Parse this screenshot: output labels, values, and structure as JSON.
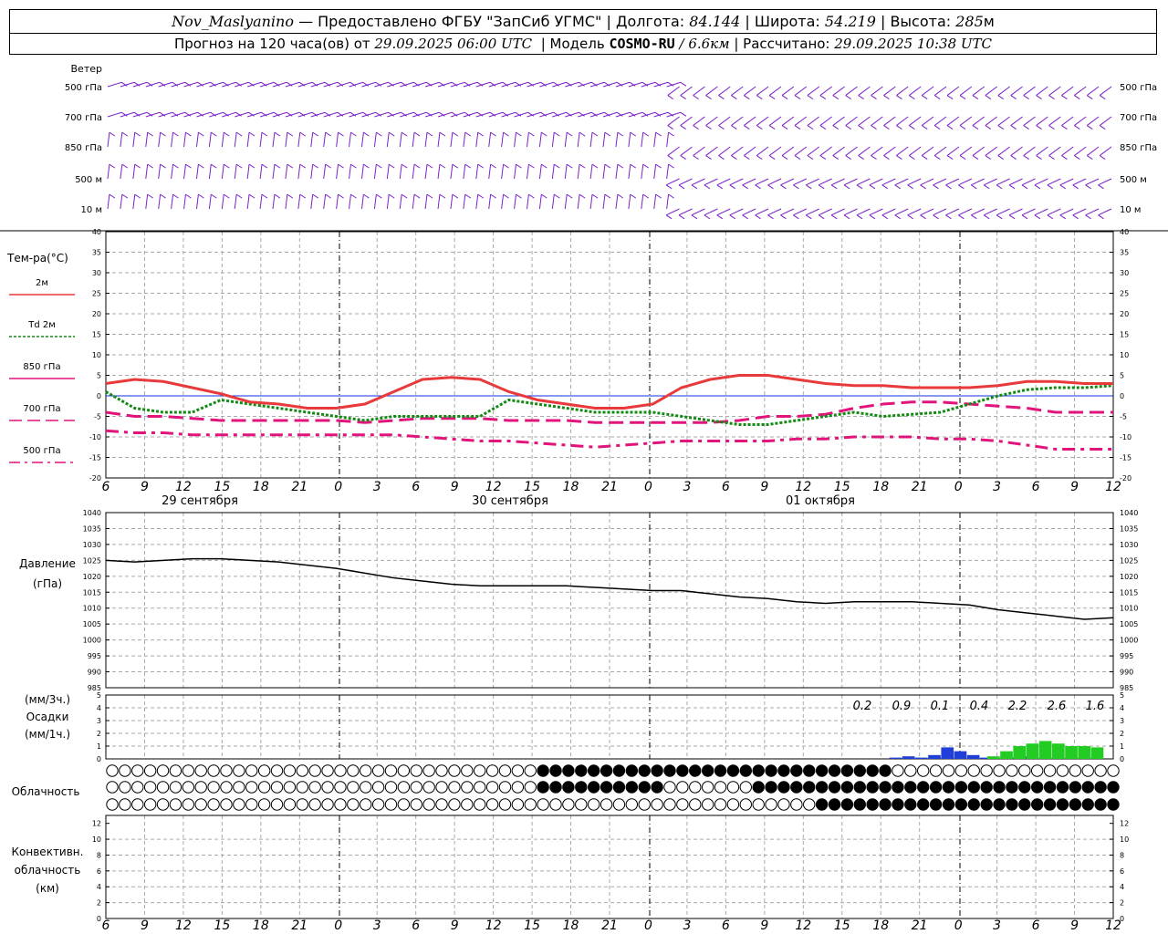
{
  "header": {
    "station": "Nov_Maslyanino",
    "provider": "— Предоставлено ФГБУ \"ЗапСиб УГМС\"",
    "lon_label": "Долгота:",
    "lon": "84.144",
    "lat_label": "Широта:",
    "lat": "54.219",
    "alt_label": "Высота:",
    "alt": "285",
    "alt_unit": "м",
    "forecast_label": "Прогноз на 120 часа(ов) от",
    "forecast_start": "29.09.2025 06:00 UTC",
    "model_label": "Модель",
    "model": "COSMO-RU",
    "resolution": "/ 6.6км",
    "calc_label": "Рассчитано:",
    "calc_time": "29.09.2025 10:38 UTC"
  },
  "wind": {
    "title": "Ветер",
    "levels": [
      "500 гПа",
      "700 гПа",
      "850 гПа",
      "500 м",
      "10  м"
    ]
  },
  "temperature": {
    "title": "Тем-ра(°С)",
    "ylim": [
      -20,
      40
    ],
    "yticks": [
      "40",
      "35",
      "30",
      "25",
      "20",
      "15",
      "10",
      "5",
      "0",
      "-5",
      "-10",
      "-15",
      "-20"
    ],
    "legend": [
      {
        "label": "2м",
        "color": "#e8393b",
        "dash": "solid"
      },
      {
        "label": "Td  2м",
        "color": "#138a13",
        "dash": "dotted"
      },
      {
        "label": "850 гПа",
        "color": "#e0147a",
        "dash": "solid"
      },
      {
        "label": "700 гПа",
        "color": "#e0147a",
        "dash": "long"
      },
      {
        "label": "500 гПа",
        "color": "#e0147a",
        "dash": "dashdot"
      }
    ],
    "hour_ticks": [
      "6",
      "9",
      "12",
      "15",
      "18",
      "21",
      "0",
      "3",
      "6",
      "9",
      "12",
      "15",
      "18",
      "21",
      "0",
      "3",
      "6",
      "9",
      "12",
      "15",
      "18",
      "21",
      "0",
      "3",
      "6",
      "9",
      "12"
    ],
    "dates": [
      "29 сентября",
      "30 сентября",
      "01 октября"
    ],
    "series": {
      "t2m": [
        3,
        4,
        3.5,
        2,
        0.5,
        -1.5,
        -2,
        -3,
        -3,
        -2,
        1,
        4,
        4.5,
        4,
        1,
        -1,
        -2,
        -3,
        -3,
        -2,
        2,
        4,
        5,
        5,
        4,
        3,
        2.5,
        2.5,
        2,
        2,
        2,
        2.5,
        3.5,
        3.5,
        3,
        3
      ],
      "td2m": [
        1,
        -3,
        -4,
        -4,
        -1,
        -2,
        -3,
        -4,
        -5,
        -6,
        -5,
        -5,
        -5,
        -5,
        -1,
        -2,
        -3,
        -4,
        -4,
        -4,
        -5,
        -6,
        -7,
        -7,
        -6,
        -5,
        -4,
        -5,
        -4.5,
        -4,
        -2,
        0,
        1.5,
        2,
        2,
        2.5
      ],
      "t700": [
        -4,
        -5,
        -5,
        -5.5,
        -6,
        -6,
        -6,
        -6,
        -6,
        -6.5,
        -6,
        -5.5,
        -5.5,
        -5.5,
        -6,
        -6,
        -6,
        -6.5,
        -6.5,
        -6.5,
        -6.5,
        -6.5,
        -6,
        -5,
        -5,
        -4.5,
        -3,
        -2,
        -1.5,
        -1.5,
        -2,
        -2.5,
        -3,
        -4,
        -4,
        -4
      ],
      "t500": [
        -8.5,
        -9,
        -9,
        -9.5,
        -9.5,
        -9.5,
        -9.5,
        -9.5,
        -9.5,
        -9.5,
        -9.5,
        -10,
        -10.5,
        -11,
        -11,
        -11.5,
        -12,
        -12.5,
        -12,
        -11.5,
        -11,
        -11,
        -11,
        -11,
        -10.5,
        -10.5,
        -10,
        -10,
        -10,
        -10.5,
        -10.5,
        -11,
        -12,
        -13,
        -13,
        -13
      ]
    }
  },
  "chart_data": [
    {
      "type": "line",
      "title": "Давление",
      "ylabel": "(гПа)",
      "ylim": [
        985,
        1040
      ],
      "yticks": [
        "1040",
        "1035",
        "1030",
        "1025",
        "1020",
        "1015",
        "1010",
        "1005",
        "1000",
        "995",
        "990",
        "985"
      ],
      "x": [
        6,
        9,
        12,
        15,
        18,
        21,
        0,
        3,
        6,
        9,
        12,
        15,
        18,
        21,
        0,
        3,
        6,
        9,
        12,
        15,
        18,
        21,
        0,
        3,
        6,
        9,
        12,
        15,
        18,
        21,
        0,
        3,
        6,
        9,
        12
      ],
      "values": [
        1025,
        1024.5,
        1025,
        1025.5,
        1025.5,
        1025,
        1024.5,
        1023.5,
        1022.5,
        1021,
        1019.5,
        1018.5,
        1017.5,
        1017,
        1017,
        1017,
        1017,
        1016.5,
        1016,
        1015.5,
        1015.5,
        1014.5,
        1013.5,
        1013,
        1012,
        1011.5,
        1012,
        1012,
        1012,
        1011.5,
        1011,
        1009.5,
        1008.5,
        1007.5,
        1006.5,
        1007
      ]
    },
    {
      "type": "bar",
      "title": "Осадки",
      "ylabel": "(мм/3ч.) (мм/1ч.)",
      "ylim": [
        0,
        5
      ],
      "yticks": [
        "5",
        "4",
        "3",
        "2",
        "1",
        "0"
      ],
      "totals": [
        {
          "value": "0.2"
        },
        {
          "value": "0.9"
        },
        {
          "value": "0.1"
        },
        {
          "value": "0.4"
        },
        {
          "value": "2.2"
        },
        {
          "value": "2.6"
        },
        {
          "value": "1.6"
        }
      ],
      "bars_1h": [
        0,
        0,
        0,
        0.1,
        0.2,
        0.1,
        0.3,
        0.9,
        0.6,
        0.3,
        0.1,
        0,
        0.1,
        0.2
      ],
      "bars_3h": [
        0.2,
        0.6,
        1.0,
        1.2,
        1.4,
        1.2,
        1.0,
        1.0,
        0.9
      ]
    }
  ],
  "cloud": {
    "title": "Облачность"
  },
  "convective": {
    "title_l1": "Конвективн.",
    "title_l2": "облачность",
    "title_l3": "(км)",
    "ylim": [
      0,
      13
    ],
    "yticks": [
      "12",
      "10",
      "8",
      "6",
      "4",
      "2",
      "0"
    ]
  }
}
